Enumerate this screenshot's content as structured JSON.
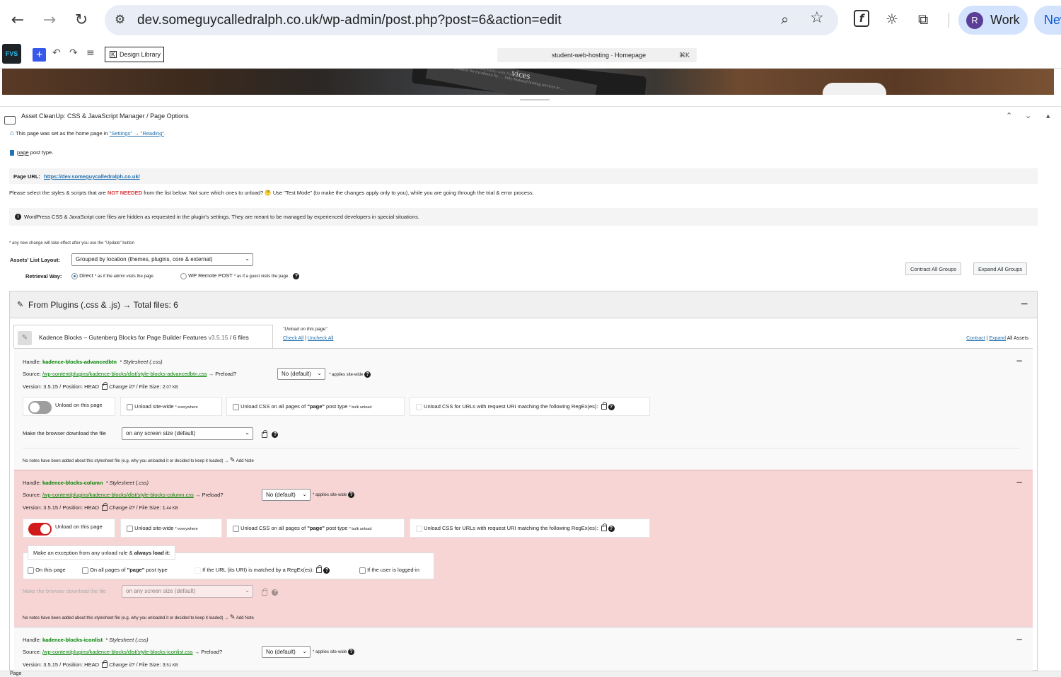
{
  "browser": {
    "url": "dev.someguycalledralph.co.uk/wp-admin/post.php?post=6&action=edit",
    "profile_initial": "R",
    "profile_label": "Work",
    "new_label": "New",
    "accent": "#d3e3fd"
  },
  "editor": {
    "design_library": "Design Library",
    "command_title": "student-web-hosting · Homepage",
    "command_shortcut": "⌘K",
    "hero_text": "vices",
    "hero_subtext": "…ed reputation for excellence by … fully-featured hosting services to …",
    "hero_subtext2": "…at Got Easier with FreeVirtual"
  },
  "panel": {
    "title": "Asset CleanUp: CSS & JavaScript Manager / Page Options",
    "home_note_prefix": "This page was set as the home page in ",
    "home_note_link": "\"Settings\" → \"Reading\"",
    "home_note_suffix": ".",
    "post_type_word": "page",
    "post_type_suffix": " post type.",
    "page_url_label": "Page URL:",
    "page_url": "https://dev.someguycalledralph.co.uk/",
    "instructions_prefix": "Please select the styles & scripts that are ",
    "instructions_strong": "NOT NEEDED",
    "instructions_suffix": " from the list below. Not sure which ones to unload? 🤔 Use \"Test Mode\" (to make the changes apply only to you), while you are going through the trial & error process.",
    "core_note": "WordPress CSS & JavaScript core files are hidden as requested in the plugin's settings. They are meant to be managed by experienced developers in special situations.",
    "update_note": "* any new change will take effect after you use the \"Update\" button",
    "layout_label": "Assets' List Layout:",
    "layout_value": "Grouped by location (themes, plugins, core & external)",
    "retrieval_label": "Retrieval Way:",
    "retrieval_direct": "Direct",
    "retrieval_direct_note": "* as if the admin visits the page",
    "retrieval_remote": "WP Remote POST",
    "retrieval_remote_note": "* as if a guest visits the page",
    "contract_all": "Contract All Groups",
    "expand_all": "Expand All Groups",
    "group_title": "From Plugins (.css & .js) → Total files: 6",
    "plugin_name": "Kadence Blocks – Gutenberg Blocks for Page Builder Features",
    "plugin_version": "v3.5.15",
    "plugin_files": "6 files",
    "unload_on_page_label": "\"Unload on this page\"",
    "check_all": "Check All",
    "uncheck_all": "Uncheck All",
    "contract": "Contract",
    "expand": "Expand",
    "all_assets": "All Assets"
  },
  "labels": {
    "handle": "Handle:",
    "stylesheet": "* Stylesheet (.css)",
    "source": "Source:",
    "preload": "Preload?",
    "preload_value": "No (default)",
    "site_wide_note": "* applies site-wide",
    "version_prefix": "Version:",
    "position": "Position: HEAD",
    "change_it": "Change it?",
    "file_size": "File Size:",
    "unload_page": "Unload on this page",
    "unload_site": "Unload site-wide",
    "everywhere": "* everywhere",
    "unload_posttype_prefix": "Unload CSS on all pages of ",
    "unload_posttype_type": "\"page\"",
    "unload_posttype_suffix": " post type",
    "bulk_unload": "* bulk unload",
    "unload_regex": "Unload CSS for URLs with request URI matching the following RegEx(es):",
    "download_label": "Make the browser download the file",
    "download_value": "on any screen size (default)",
    "notes": "No notes have been added about this stylesheet file (e.g. why you unloaded it or decided to keep it loaded) →",
    "add_note": "Add Note",
    "exception_title_prefix": "Make an exception from any unload rule & ",
    "exception_title_strong": "always load it",
    "exception_title_suffix": ":",
    "exc_this_page": "On this page",
    "exc_posttype_prefix": "On all pages of ",
    "exc_posttype_type": "\"page\"",
    "exc_posttype_suffix": " post type",
    "exc_regex": "If the URL (its URI) is matched by a RegEx(es):",
    "exc_logged_in": "If the user is logged-in"
  },
  "assets": [
    {
      "handle": "kadence-blocks-advancedbtn",
      "source": "/wp-content/plugins/kadence-blocks/dist/style-blocks-advancedbtn.css",
      "version": "3.5.15",
      "size_int": "2",
      "size_dec": ".07 KB",
      "unloaded": false
    },
    {
      "handle": "kadence-blocks-column",
      "source": "/wp-content/plugins/kadence-blocks/dist/style-blocks-column.css",
      "version": "3.5.15",
      "size_int": "1",
      "size_dec": ".44 KB",
      "unloaded": true
    },
    {
      "handle": "kadence-blocks-iconlist",
      "source": "/wp-content/plugins/kadence-blocks/dist/style-blocks-iconlist.css",
      "version": "3.5.15",
      "size_int": "3",
      "size_dec": ".51 KB",
      "unloaded": false
    }
  ],
  "footer": {
    "breadcrumb": "Page"
  },
  "colors": {
    "unloaded_bg": "#f7d5d5",
    "handle_green": "#008000",
    "toggle_on": "#d11a1a",
    "toggle_off": "#9e9e9e",
    "not_needed_red": "#d63638"
  }
}
